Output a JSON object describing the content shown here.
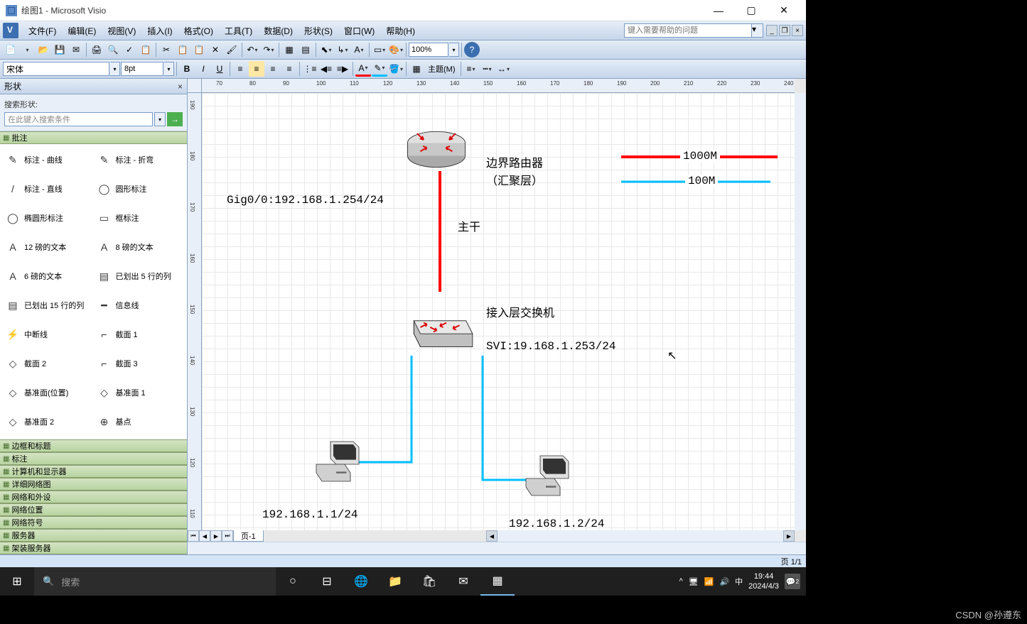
{
  "title": "绘图1 - Microsoft Visio",
  "menu": {
    "file": "文件(F)",
    "edit": "编辑(E)",
    "view": "视图(V)",
    "insert": "插入(I)",
    "format": "格式(O)",
    "tools": "工具(T)",
    "data": "数据(D)",
    "shape": "形状(S)",
    "window": "窗口(W)",
    "help": "帮助(H)"
  },
  "help_placeholder": "键入需要帮助的问题",
  "zoom": "100%",
  "font": {
    "name": "宋体",
    "size": "8pt"
  },
  "theme_btn": "主题(M)",
  "shapes_panel": {
    "title": "形状",
    "search_label": "搜索形状:",
    "search_placeholder": "在此键入搜索条件",
    "current_stencil": "批注",
    "shapes": [
      {
        "label": "标注 - 曲线"
      },
      {
        "label": "标注 - 折弯"
      },
      {
        "label": "标注 - 直线"
      },
      {
        "label": "圆形标注"
      },
      {
        "label": "椭圆形标注"
      },
      {
        "label": "框标注"
      },
      {
        "label": "12 磅的文本"
      },
      {
        "label": "8 磅的文本"
      },
      {
        "label": "6 磅的文本"
      },
      {
        "label": "已划出 5 行的列"
      },
      {
        "label": "已划出 15 行的列"
      },
      {
        "label": "信息线"
      },
      {
        "label": "中断线"
      },
      {
        "label": "截面 1"
      },
      {
        "label": "截面 2"
      },
      {
        "label": "截面 3"
      },
      {
        "label": "基准面(位置)"
      },
      {
        "label": "基准面 1"
      },
      {
        "label": "基准面 2"
      },
      {
        "label": "基点"
      }
    ],
    "stencils": [
      "边框和标题",
      "标注",
      "计算机和显示器",
      "详细网络图",
      "网络和外设",
      "网络位置",
      "网络符号",
      "服务器",
      "架装服务器"
    ]
  },
  "canvas": {
    "router_label1": "边界路由器",
    "router_label2": "（汇聚层）",
    "router_if": "Gig0/0:192.168.1.254/24",
    "trunk": "主干",
    "switch_label": "接入层交换机",
    "switch_svi": "SVI:19.168.1.253/24",
    "pc1_ip": "192.168.1.1/24",
    "pc2_ip": "192.168.1.2/24",
    "legend_1000": "1000M",
    "legend_100": "100M"
  },
  "page_tab": "页-1",
  "status_pages": "页 1/1",
  "taskbar": {
    "search": "搜索",
    "ime": "中",
    "time": "19:44",
    "date": "2024/4/3",
    "notif": "2"
  },
  "watermark": "CSDN @孙遵东",
  "ruler_h": [
    "70",
    "80",
    "90",
    "100",
    "110",
    "120",
    "130",
    "140",
    "150",
    "160",
    "170",
    "180",
    "190",
    "200",
    "210",
    "220",
    "230",
    "240"
  ],
  "ruler_v": [
    "190",
    "180",
    "170",
    "160",
    "150",
    "140",
    "130",
    "120",
    "110"
  ]
}
